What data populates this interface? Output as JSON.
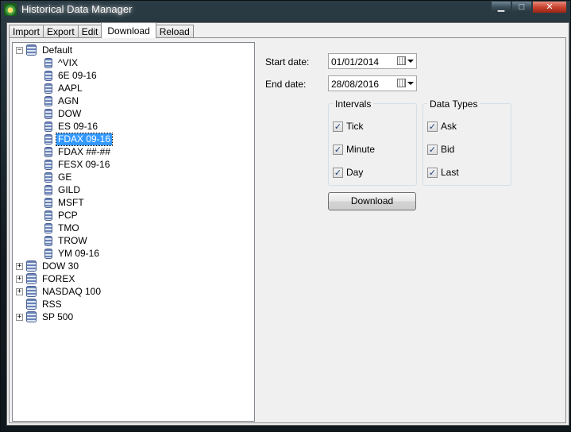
{
  "window": {
    "title": "Historical Data Manager"
  },
  "tabs": [
    {
      "label": "Import"
    },
    {
      "label": "Export"
    },
    {
      "label": "Edit"
    },
    {
      "label": "Download"
    },
    {
      "label": "Reload"
    }
  ],
  "tree": {
    "root": "Default",
    "children": [
      "^VIX",
      "6E 09-16",
      "AAPL",
      "AGN",
      "DOW",
      "ES 09-16",
      "FDAX 09-16",
      "FDAX ##-##",
      "FESX 09-16",
      "GE",
      "GILD",
      "MSFT",
      "PCP",
      "TMO",
      "TROW",
      "YM 09-16"
    ],
    "selected": "FDAX 09-16",
    "groups": [
      "DOW 30",
      "FOREX",
      "NASDAQ 100",
      "RSS",
      "SP 500"
    ]
  },
  "download": {
    "start_label": "Start date:",
    "start_value": "01/01/2014",
    "end_label": "End date:",
    "end_value": "28/08/2016",
    "intervals_title": "Intervals",
    "intervals": [
      {
        "label": "Tick",
        "checked": true
      },
      {
        "label": "Minute",
        "checked": true
      },
      {
        "label": "Day",
        "checked": true
      }
    ],
    "types_title": "Data Types",
    "types": [
      {
        "label": "Ask",
        "checked": true
      },
      {
        "label": "Bid",
        "checked": true
      },
      {
        "label": "Last",
        "checked": true
      }
    ],
    "button_label": "Download"
  },
  "icons": {
    "check": "check-icon",
    "collapse": "minus",
    "expand": "plus"
  }
}
